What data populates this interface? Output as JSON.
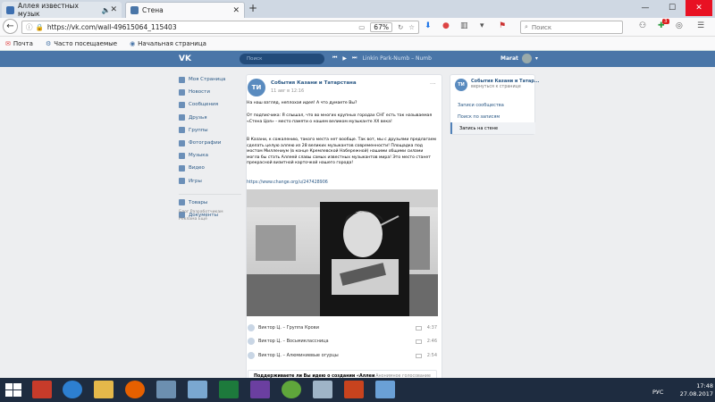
{
  "browser": {
    "tab1_title": "Аллея известных музык",
    "tab2_title": "Стена",
    "url": "https://vk.com/wall-49615064_115403",
    "zoom": "67%",
    "search_placeholder": "Поиск",
    "bookmarks": [
      "Почта",
      "Часто посещаемые",
      "Начальная страница"
    ],
    "notif_count": "3"
  },
  "vk": {
    "logo": "VK",
    "search_placeholder": "Поиск",
    "now_playing": "Linkin Park-Numb – Numb",
    "user_name": "Marat",
    "menu": [
      "Моя Страница",
      "Новости",
      "Сообщения",
      "Друзья",
      "Группы",
      "Фотографии",
      "Музыка",
      "Видео",
      "Игры",
      "Товары",
      "Документы"
    ],
    "menu_footer": [
      "Блог  Разработчикам",
      "Реклама  Ещё"
    ],
    "post": {
      "avatar_text": "ТИ",
      "author": "События Казани и Татарстана",
      "date": "11 авг в 12:16",
      "p1": "На наш взгляд, неплохая идея! А что думаете Вы?",
      "p2": "От подписчика: Я слышал, что во многих крупных городах СНГ есть так называемая «Стена Цоя» - место памяти о нашем великом музыканте XX века!",
      "p3": "В Казани, к сожалению, такого места нет вообще. Так вот, мы с друзьями предлагаем сделать целую аллею из 28 великих музыкантов современности! Площадка под мостом Миллениум (в конце Кремлевской Набережной) нашими общими силами могла бы стать Аллеей славы самых известных музыкантов мира! Это место станет прекрасной визитной карточкой нашего города!",
      "link": "https://www.change.org/u/247428906",
      "tracks": [
        {
          "title": "Виктор Ц. – Группа Крови",
          "dur": "4:37"
        },
        {
          "title": "Виктор Ц. – Восьмиклассница",
          "dur": "2:46"
        },
        {
          "title": "Виктор Ц. – Алюминиевые огурцы",
          "dur": "2:54"
        }
      ],
      "poll_title": "Поддерживаете ли Вы идею о создании «Аллеи",
      "poll_type": "Анонимное голосование"
    },
    "right": {
      "avatar_text": "ТИ",
      "name": "События Казани и Татар...",
      "back": "вернуться к странице",
      "links": [
        "Записи сообщества",
        "Поиск по записям",
        "Запись на стене"
      ]
    }
  },
  "taskbar": {
    "lang": "РУС",
    "time": "17:48",
    "date": "27.08.2017"
  }
}
